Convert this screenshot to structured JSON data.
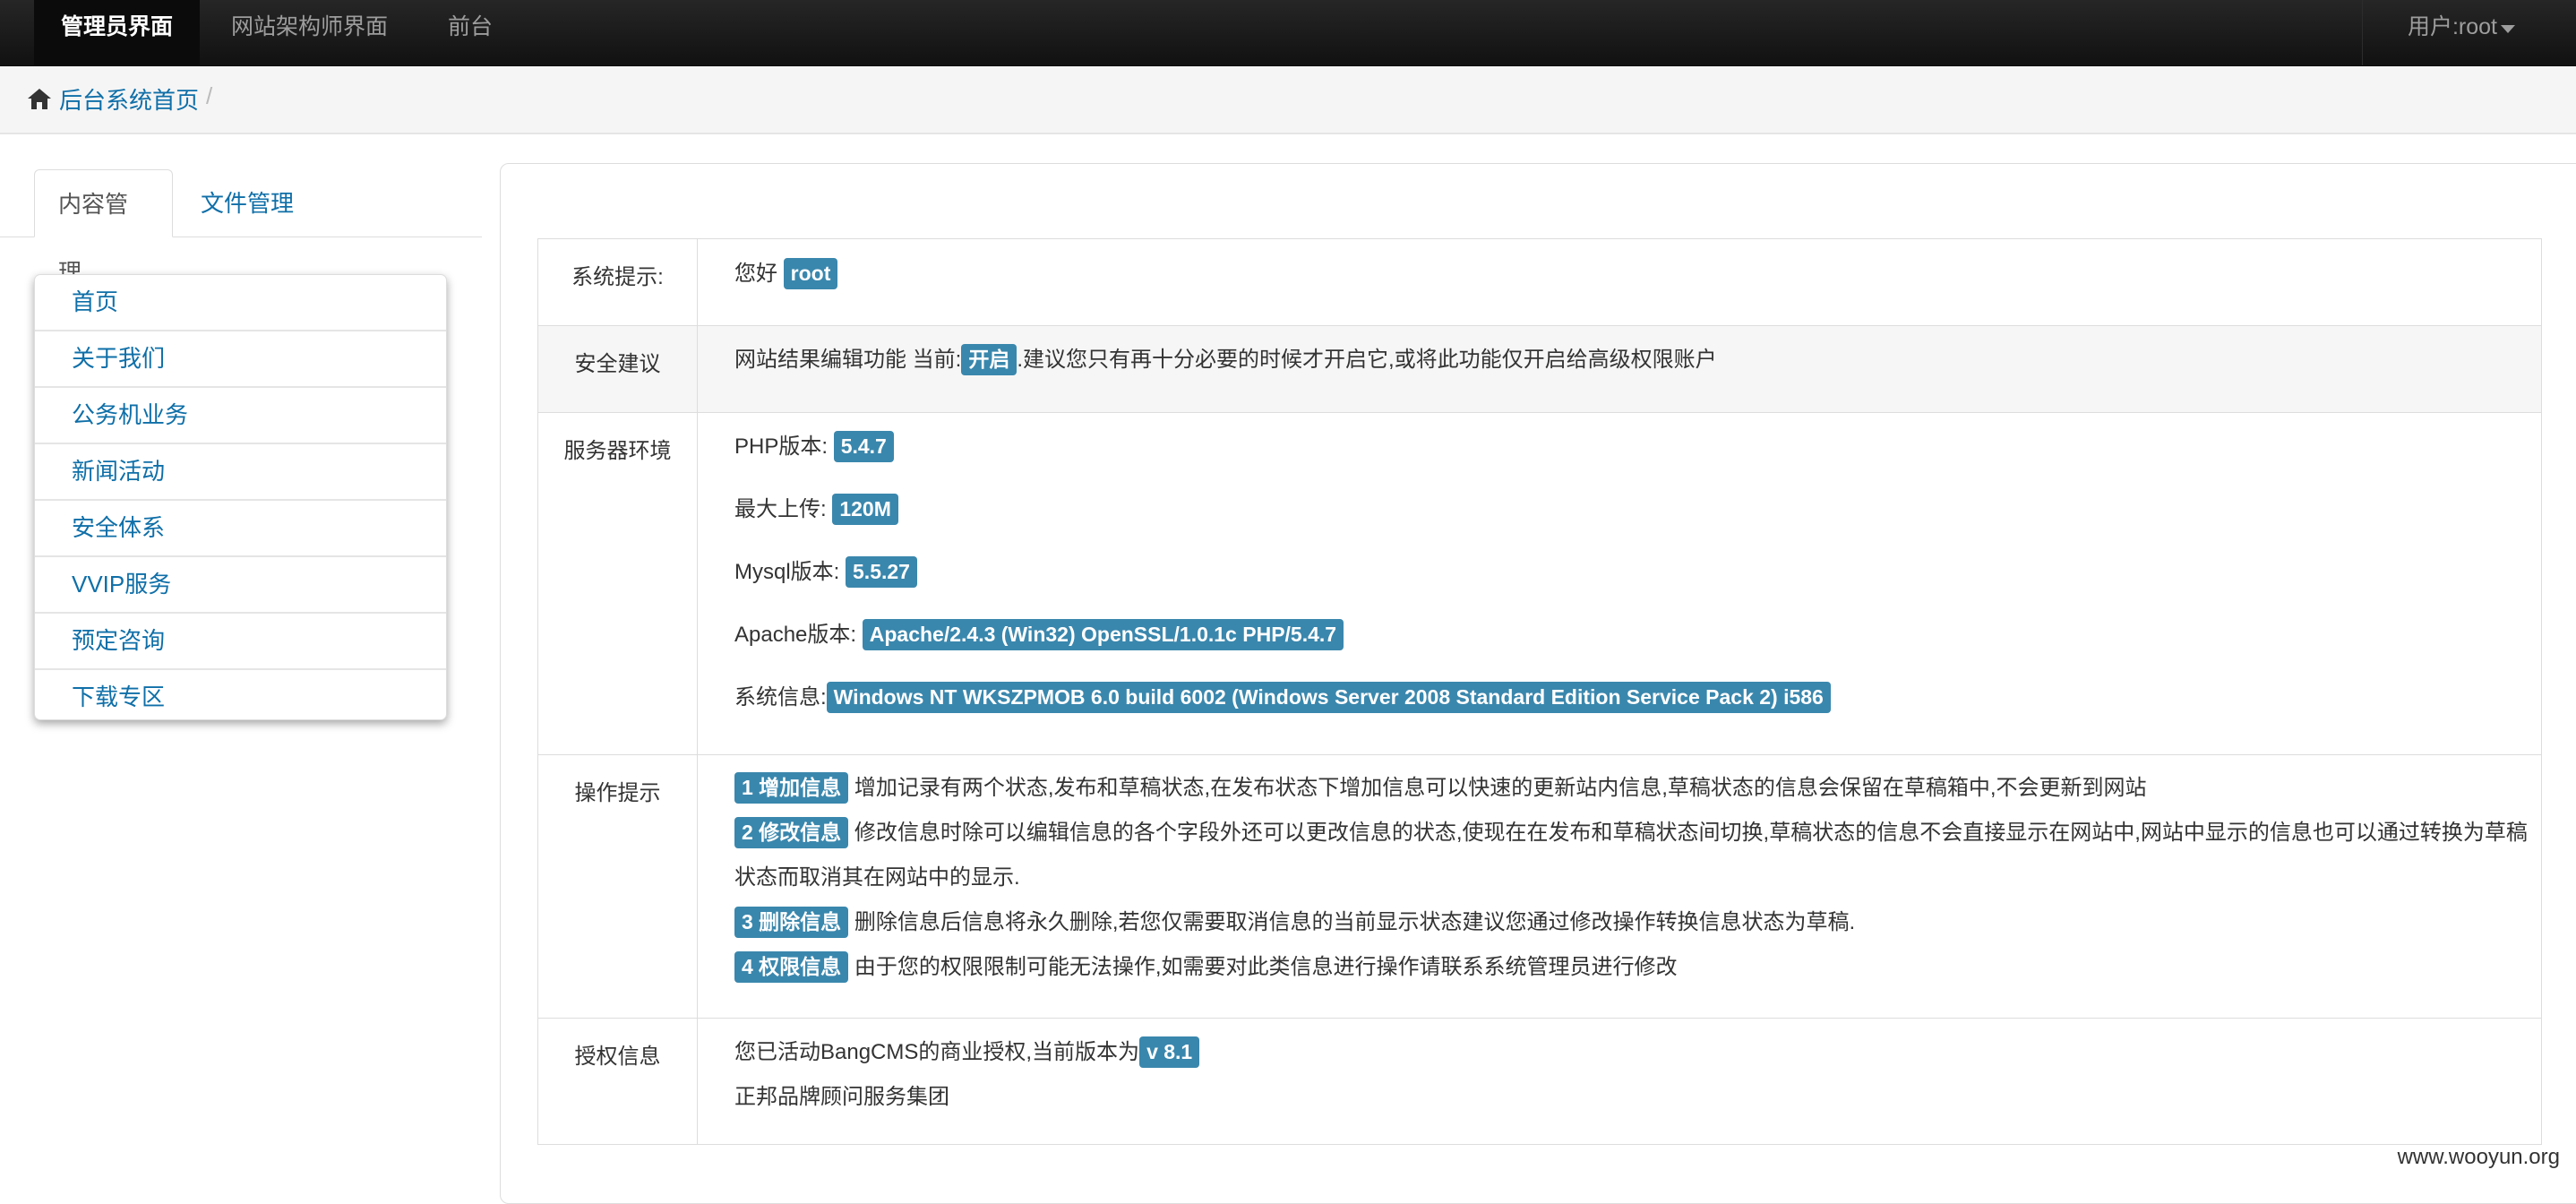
{
  "navbar": {
    "items": [
      "管理员界面",
      "网站架构师界面",
      "前台"
    ],
    "user": "用户:root"
  },
  "breadcrumb": {
    "home": "后台系统首页",
    "separator": "/"
  },
  "sidebar": {
    "tabs": [
      "内容管理",
      "文件管理"
    ],
    "menu": [
      "首页",
      "关于我们",
      "公务机业务",
      "新闻活动",
      "安全体系",
      "VVIP服务",
      "预定咨询",
      "下载专区"
    ]
  },
  "table": {
    "system_tip": {
      "label": "系统提示:",
      "greeting": "您好",
      "user": "root"
    },
    "security": {
      "label": "安全建议",
      "prefix": "网站结果编辑功能 当前:",
      "status": "开启",
      "suffix": ".建议您只有再十分必要的时候才开启它,或将此功能仅开启给高级权限账户"
    },
    "server": {
      "label": "服务器环境",
      "php_label": "PHP版本:",
      "php": "5.4.7",
      "upload_label": "最大上传:",
      "upload": "120M",
      "mysql_label": "Mysql版本:",
      "mysql": "5.5.27",
      "apache_label": "Apache版本:",
      "apache": "Apache/2.4.3 (Win32) OpenSSL/1.0.1c PHP/5.4.7",
      "sys_label": "系统信息:",
      "sys": "Windows NT WKSZPMOB 6.0 build 6002 (Windows Server 2008 Standard Edition Service Pack 2) i586"
    },
    "ops": {
      "label": "操作提示",
      "items": [
        {
          "badge": "1 增加信息",
          "text": "增加记录有两个状态,发布和草稿状态,在发布状态下增加信息可以快速的更新站内信息,草稿状态的信息会保留在草稿箱中,不会更新到网站"
        },
        {
          "badge": "2 修改信息",
          "text": "修改信息时除可以编辑信息的各个字段外还可以更改信息的状态,使现在在发布和草稿状态间切换,草稿状态的信息不会直接显示在网站中,网站中显示的信息也可以通过转换为草稿",
          "cont": "状态而取消其在网站中的显示."
        },
        {
          "badge": "3 删除信息",
          "text": "删除信息后信息将永久删除,若您仅需要取消信息的当前显示状态建议您通过修改操作转换信息状态为草稿."
        },
        {
          "badge": "4 权限信息",
          "text": "由于您的权限限制可能无法操作,如需要对此类信息进行操作请联系系统管理员进行修改"
        }
      ]
    },
    "license": {
      "label": "授权信息",
      "text": "您已活动BangCMS的商业授权,当前版本为",
      "version": "v 8.1",
      "company": "正邦品牌顾问服务集团"
    }
  },
  "watermark": "www.wooyun.org"
}
